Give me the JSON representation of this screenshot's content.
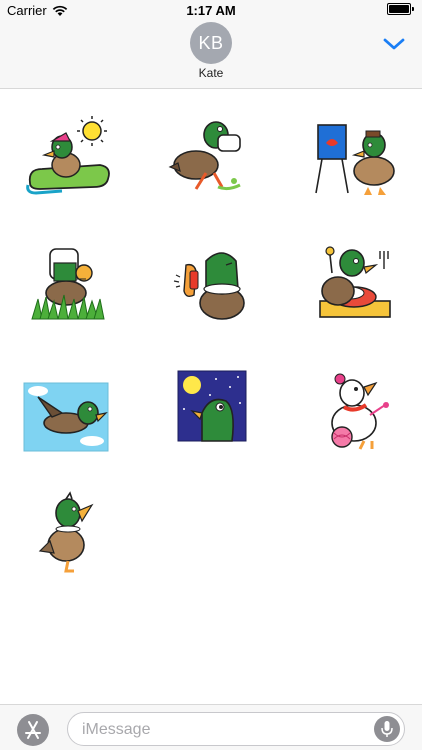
{
  "status_bar": {
    "carrier": "Carrier",
    "time": "1:17 AM"
  },
  "header": {
    "avatar_initials": "KB",
    "contact_name": "Kate",
    "chevron_icon": "chevron-down-icon",
    "accent_color": "#1a7ef5"
  },
  "stickers": [
    {
      "name": "duck-on-sled-sticker"
    },
    {
      "name": "duck-with-mask-sticker"
    },
    {
      "name": "duck-painting-sticker"
    },
    {
      "name": "duck-in-grass-sticker"
    },
    {
      "name": "duck-on-phone-sticker"
    },
    {
      "name": "duck-cooking-sticker"
    },
    {
      "name": "duck-flying-sticker"
    },
    {
      "name": "duck-moon-night-sticker"
    },
    {
      "name": "duck-knitting-sticker"
    },
    {
      "name": "duck-walking-sticker"
    }
  ],
  "input_bar": {
    "placeholder": "iMessage",
    "apps_icon": "app-store-icon",
    "mic_icon": "microphone-icon"
  }
}
